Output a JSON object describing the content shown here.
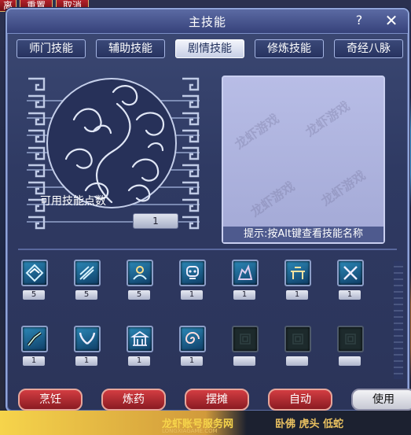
{
  "top_buttons": [
    "离",
    "重置",
    "取消"
  ],
  "window": {
    "title": "主技能",
    "help": "?",
    "close": "✕"
  },
  "tabs": [
    {
      "label": "师门技能",
      "active": false
    },
    {
      "label": "辅助技能",
      "active": false
    },
    {
      "label": "剧情技能",
      "active": true
    },
    {
      "label": "修炼技能",
      "active": false
    },
    {
      "label": "奇经八脉",
      "active": false
    }
  ],
  "points": {
    "label": "可用技能点数",
    "value": "1"
  },
  "description": {
    "hint": "提示:按Alt键查看技能名称",
    "watermarks": [
      "龙虾游戏",
      "龙虾游戏",
      "龙虾游戏",
      "龙虾游戏"
    ]
  },
  "skills": [
    {
      "icon": "diamond-arrow-icon",
      "level": "5"
    },
    {
      "icon": "broken-line-icon",
      "level": "5"
    },
    {
      "icon": "nature-spirit-icon",
      "level": "5"
    },
    {
      "icon": "skull-icon",
      "level": "1"
    },
    {
      "icon": "rock-figure-icon",
      "level": "1"
    },
    {
      "icon": "table-build-icon",
      "level": "1"
    },
    {
      "icon": "crossed-blades-icon",
      "level": "1"
    },
    {
      "icon": "hand-blade-icon",
      "level": "1"
    },
    {
      "icon": "wings-icon",
      "level": "1"
    },
    {
      "icon": "temple-icon",
      "level": "1"
    },
    {
      "icon": "swirl-icon",
      "level": "1"
    },
    {
      "icon": "empty-slot-icon",
      "level": ""
    },
    {
      "icon": "empty-slot-icon",
      "level": ""
    },
    {
      "icon": "empty-slot-icon",
      "level": ""
    }
  ],
  "actions": [
    "烹饪",
    "炼药",
    "摆摊",
    "自动",
    "使用"
  ],
  "footer": {
    "brand": "龙虾账号服务网",
    "url": "LONGXIAGAME.COM",
    "right": "卧佛 虎头 低蛇"
  },
  "colors": {
    "window_bg": "#2f3a63",
    "tab_active": "#e4e8f4",
    "action_red": "#b42a31"
  }
}
